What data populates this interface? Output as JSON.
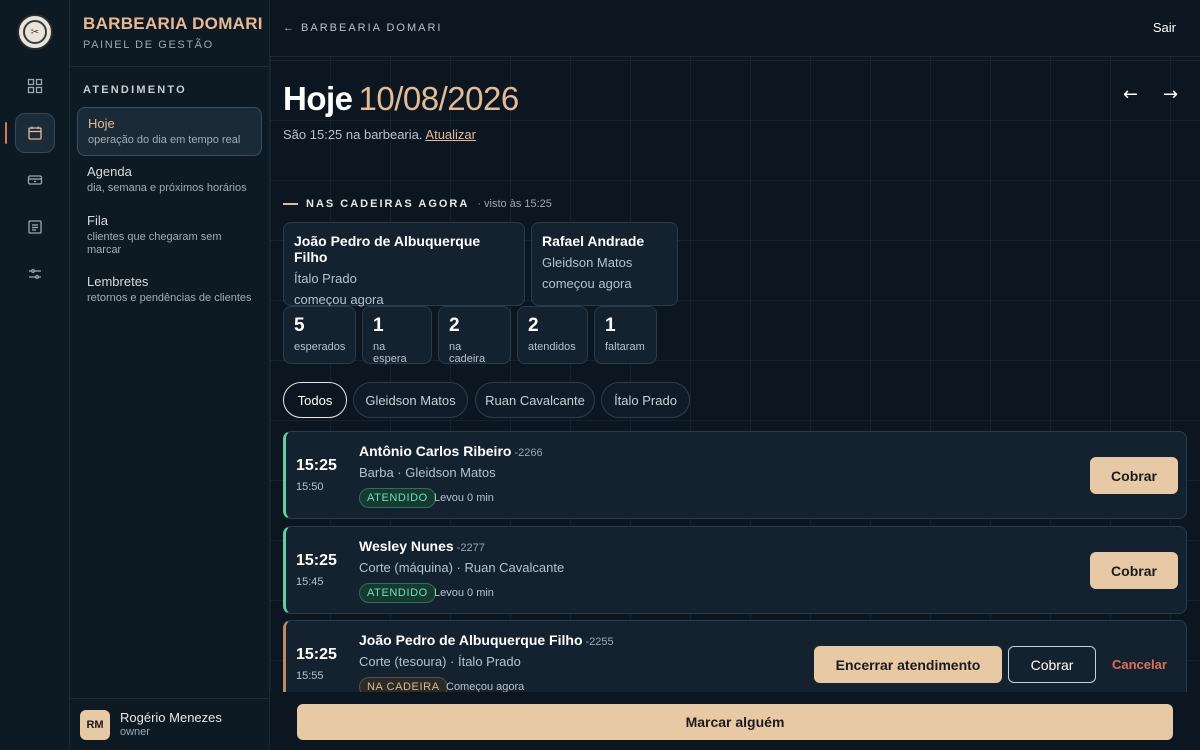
{
  "app": {
    "name": "BARBEARIA DOMARI",
    "subtitle": "PAINEL DE GESTÃO"
  },
  "colors": {
    "accent": "#e8c9a6",
    "done": "#5fd0a4",
    "danger": "#e06f5a",
    "background": "#0b1620"
  },
  "rail": {
    "icons": [
      "grid-icon",
      "calendar-icon",
      "ticket-icon",
      "list-icon",
      "sliders-icon"
    ],
    "active_index": 1
  },
  "sidebar": {
    "section": "ATENDIMENTO",
    "items": [
      {
        "label": "Hoje",
        "desc": "operação do dia em tempo real",
        "active": true
      },
      {
        "label": "Agenda",
        "desc": "dia, semana e próximos horários"
      },
      {
        "label": "Fila",
        "desc": "clientes que chegaram sem marcar"
      },
      {
        "label": "Lembretes",
        "desc": "retornos e pendências de clientes"
      }
    ],
    "user": {
      "initials": "RM",
      "name": "Rogério Menezes",
      "role": "owner"
    }
  },
  "topbar": {
    "back": "← BARBEARIA DOMARI",
    "logout": "Sair"
  },
  "header": {
    "title": "Hoje",
    "date": "10/08/2026",
    "prev": "←",
    "next": "→",
    "status": "São 15:25 na barbearia.",
    "refresh": "Atualizar"
  },
  "chairs": {
    "title": "NAS CADEIRAS AGORA",
    "seen": "· visto às 15:25",
    "cards": [
      {
        "client": "João Pedro de Albuquerque Filho",
        "barber": "Ítalo Prado",
        "time": "começou agora"
      },
      {
        "client": "Rafael Andrade",
        "barber": "Gleidson Matos",
        "time": "começou agora"
      }
    ]
  },
  "stats": [
    {
      "value": "5",
      "label": "esperados"
    },
    {
      "value": "1",
      "label": "na espera"
    },
    {
      "value": "2",
      "label": "na cadeira"
    },
    {
      "value": "2",
      "label": "atendidos"
    },
    {
      "value": "1",
      "label": "faltaram"
    }
  ],
  "filters": [
    "Todos",
    "Gleidson Matos",
    "Ruan Cavalcante",
    "Ítalo Prado"
  ],
  "appointments": [
    {
      "time": "15:25",
      "end": "15:50",
      "client": "Antônio Carlos Ribeiro",
      "code": "-2266",
      "service": "Barba · Gleidson Matos",
      "status": "ATENDIDO",
      "note": "Levou 0 min",
      "action": "Cobrar"
    },
    {
      "time": "15:25",
      "end": "15:45",
      "client": "Wesley Nunes",
      "code": "-2277",
      "service": "Corte (máquina) · Ruan Cavalcante",
      "status": "ATENDIDO",
      "note": "Levou 0 min",
      "action": "Cobrar"
    },
    {
      "time": "15:25",
      "end": "15:55",
      "client": "João Pedro de Albuquerque Filho",
      "code": "-2255",
      "service": "Corte (tesoura) · Ítalo Prado",
      "status": "NA CADEIRA",
      "note": "Começou agora",
      "action_primary": "Encerrar atendimento",
      "action_secondary": "Cobrar",
      "action_cancel": "Cancelar"
    }
  ],
  "bottom": {
    "book": "Marcar alguém"
  }
}
